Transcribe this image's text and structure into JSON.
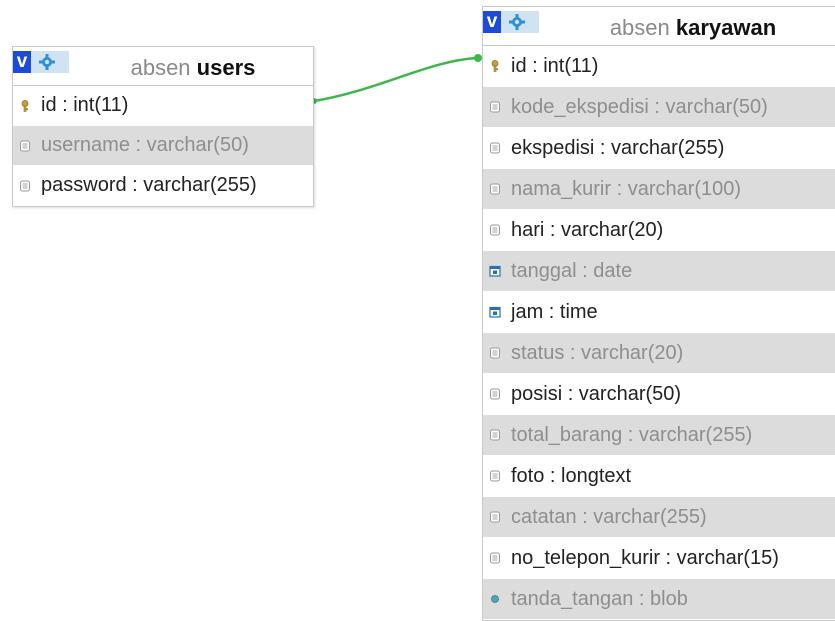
{
  "colors": {
    "relation_line": "#3cb84a",
    "header_v": "#1c4bd8",
    "header_gear_bg": "#cfe3f4",
    "shaded_row": "#dcdcdc"
  },
  "tables": {
    "users": {
      "prefix": "absen",
      "name": "users",
      "v_label": "v",
      "columns": [
        {
          "label": "id : int(11)",
          "icon": "key-icon",
          "shaded": false
        },
        {
          "label": "username : varchar(50)",
          "icon": "column-icon",
          "shaded": true
        },
        {
          "label": "password : varchar(255)",
          "icon": "column-icon",
          "shaded": false
        }
      ]
    },
    "karyawan": {
      "prefix": "absen",
      "name": "karyawan",
      "v_label": "v",
      "columns": [
        {
          "label": "id : int(11)",
          "icon": "key-icon",
          "shaded": false
        },
        {
          "label": "kode_ekspedisi : varchar(50)",
          "icon": "column-icon",
          "shaded": true
        },
        {
          "label": "ekspedisi : varchar(255)",
          "icon": "column-icon",
          "shaded": false
        },
        {
          "label": "nama_kurir : varchar(100)",
          "icon": "column-icon",
          "shaded": true
        },
        {
          "label": "hari : varchar(20)",
          "icon": "column-icon",
          "shaded": false
        },
        {
          "label": "tanggal : date",
          "icon": "date-icon",
          "shaded": true
        },
        {
          "label": "jam : time",
          "icon": "date-icon",
          "shaded": false
        },
        {
          "label": "status : varchar(20)",
          "icon": "column-icon",
          "shaded": true
        },
        {
          "label": "posisi : varchar(50)",
          "icon": "column-icon",
          "shaded": false
        },
        {
          "label": "total_barang : varchar(255)",
          "icon": "column-icon",
          "shaded": true
        },
        {
          "label": "foto : longtext",
          "icon": "column-icon",
          "shaded": false
        },
        {
          "label": "catatan : varchar(255)",
          "icon": "column-icon",
          "shaded": true
        },
        {
          "label": "no_telepon_kurir : varchar(15)",
          "icon": "column-icon",
          "shaded": false
        },
        {
          "label": "tanda_tangan : blob",
          "icon": "blob-icon",
          "shaded": true
        }
      ]
    }
  }
}
